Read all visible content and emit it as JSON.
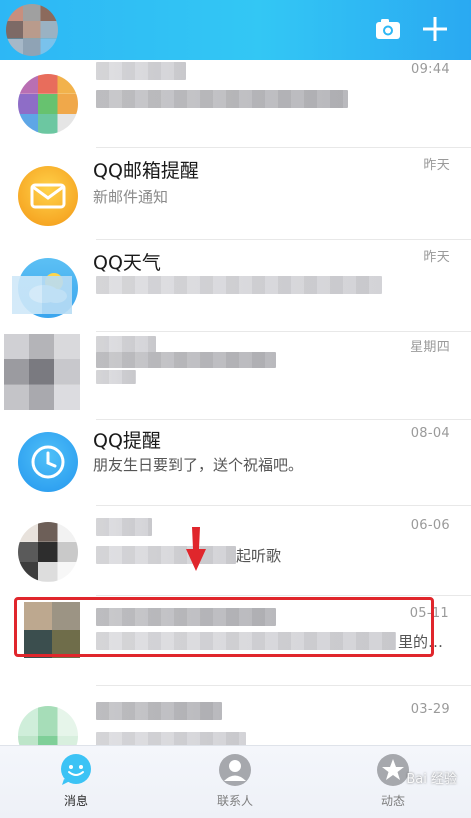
{
  "header": {
    "camera_icon": "camera-icon",
    "add_icon": "plus-icon"
  },
  "chats": [
    {
      "name": "",
      "message": "",
      "time": "09:44"
    },
    {
      "name": "QQ邮箱提醒",
      "message": "新邮件通知",
      "time": "昨天"
    },
    {
      "name": "QQ天气",
      "message": "",
      "time": "昨天"
    },
    {
      "name": "",
      "message": "",
      "time": "星期四"
    },
    {
      "name": "QQ提醒",
      "message": "朋友生日要到了，送个祝福吧。",
      "time": "08-04"
    },
    {
      "name": "",
      "message": "起听歌",
      "time": "06-06"
    },
    {
      "name": "",
      "message": "里的…",
      "time": "05-11"
    },
    {
      "name": "",
      "message": "",
      "time": "03-29"
    }
  ],
  "tabs": [
    {
      "label": "消息",
      "icon": "chat-bubble-icon",
      "active": true
    },
    {
      "label": "联系人",
      "icon": "contacts-icon",
      "active": false
    },
    {
      "label": "动态",
      "icon": "star-planet-icon",
      "active": false
    }
  ],
  "watermark": "Bai 经验",
  "colors": {
    "header": "#2db7f5",
    "highlight": "#e0262c",
    "active_tab": "#3cc3f5"
  }
}
